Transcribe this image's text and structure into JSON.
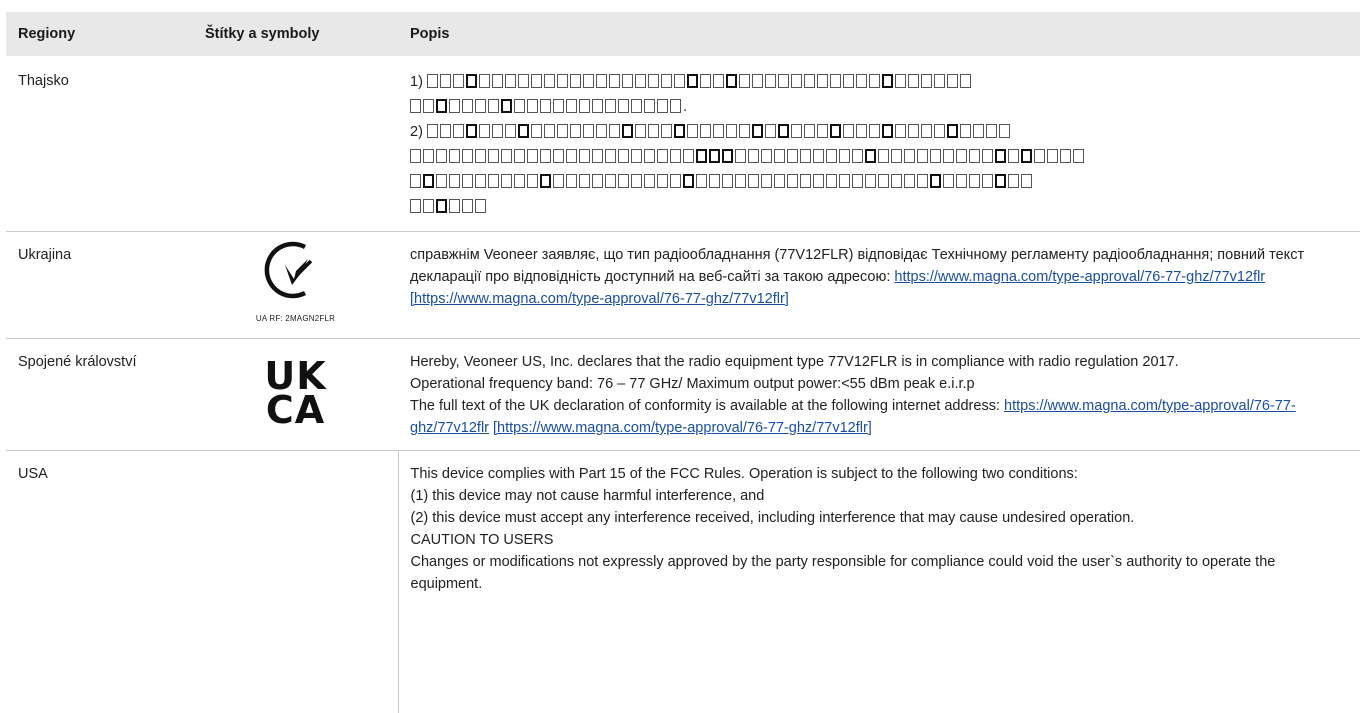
{
  "table": {
    "headers": [
      "Regiony",
      "Štítky a symboly",
      "Popis"
    ],
    "thailand": {
      "region": "Thajsko",
      "line1_prefix": "1)",
      "line1_suffix": ".",
      "line2_prefix": "2)"
    },
    "ukraine": {
      "region": "Ukrajina",
      "symbol_caption": "UA RF: 2MAGN2FLR",
      "text": "справжнім Veoneer заявляє, що тип радіообладнання (77V12FLR) відповідає Технічному регламенту радіообладнання; повний текст декларації про відповідність доступний на веб-сайті за такою адресою: ",
      "link1": "https://www.magna.com/type-approval/76-77-ghz/77v12flr",
      "link2": "[https://www.magna.com/type-approval/76-77-ghz/77v12flr]"
    },
    "uk": {
      "region": "Spojené království",
      "symbol_line1": "UK",
      "symbol_line2": "CA",
      "line1": "Hereby, Veoneer US, Inc. declares that the radio equipment type 77V12FLR is in compliance with radio regulation 2017.",
      "line2": "Operational frequency band: 76 – 77 GHz/ Maximum output power:<55 dBm peak e.i.r.p",
      "line3": "The full text of the UK declaration of conformity is available at the following internet address: ",
      "link1": "https://www.magna.com/type-approval/76-77-ghz/77v12flr",
      "link2": "[https://www.magna.com/type-approval/76-77-ghz/77v12flr]"
    },
    "usa": {
      "region": "USA",
      "line1": "This device complies with Part 15 of the FCC Rules. Operation is subject to the following two conditions:",
      "line2": "(1) this device may not cause harmful interference, and",
      "line3": "(2) this device must accept any interference received, including interference that may cause undesired operation.",
      "line4": "CAUTION TO USERS",
      "line5": "Changes or modifications not expressly approved by the party responsible for compliance could void the user`s authority to operate the equipment."
    }
  },
  "colors": {
    "header_bg": "#e8e8e8",
    "link": "#1a4fa0",
    "border": "#c9c9c9"
  }
}
